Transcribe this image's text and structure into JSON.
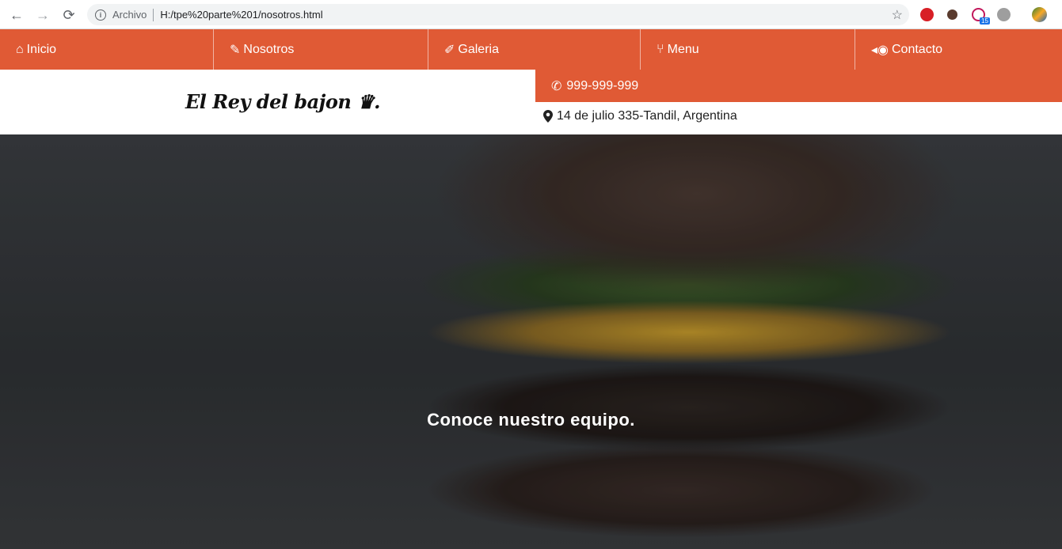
{
  "browser": {
    "scheme_label": "Archivo",
    "url": "H:/tpe%20parte%201/nosotros.html",
    "extension_badge": "15"
  },
  "nav": {
    "items": [
      {
        "label": "Inicio",
        "icon": "home-icon"
      },
      {
        "label": "Nosotros",
        "icon": "carrot-icon"
      },
      {
        "label": "Galeria",
        "icon": "drumstick-icon"
      },
      {
        "label": "Menu",
        "icon": "utensils-icon"
      },
      {
        "label": "Contacto",
        "icon": "fish-icon"
      }
    ]
  },
  "header": {
    "logo": "El Rey del bajon ♛.",
    "phone": "999-999-999",
    "address": "14 de julio 335-Tandil, Argentina"
  },
  "hero": {
    "caption": "Conoce nuestro equipo."
  },
  "colors": {
    "accent": "#e05a35"
  }
}
